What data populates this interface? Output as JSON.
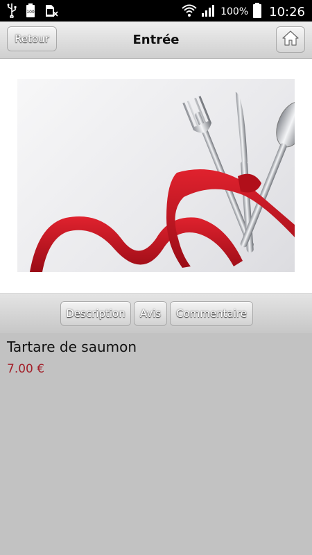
{
  "status_bar": {
    "battery_percent": "100%",
    "clock": "10:26",
    "icons": [
      "usb-icon",
      "battery-100-icon",
      "sim-blocked-icon",
      "wifi-icon",
      "signal-icon",
      "battery-icon"
    ]
  },
  "header": {
    "back_label": "Retour",
    "title": "Entrée",
    "home_icon": "home-icon"
  },
  "photo": {
    "description_icon": "cutlery-with-red-ribbon-image"
  },
  "tabs": [
    {
      "label": "Description"
    },
    {
      "label": "Avis"
    },
    {
      "label": "Commentaire"
    }
  ],
  "dish": {
    "name": "Tartare de saumon",
    "price": "7.00 €"
  },
  "colors": {
    "price": "#a3202a",
    "ribbon": "#c8121f"
  }
}
